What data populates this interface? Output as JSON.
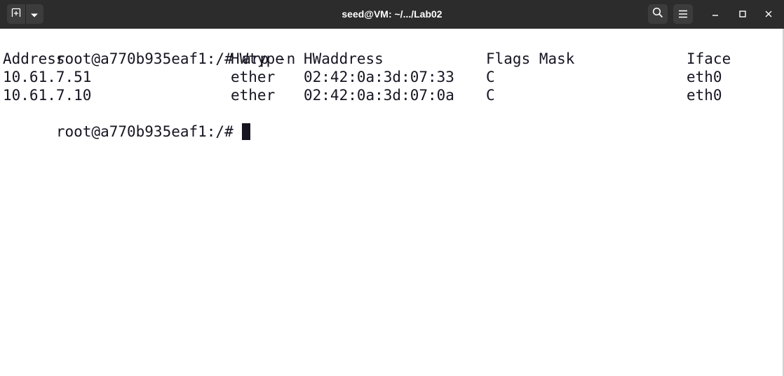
{
  "window": {
    "title": "seed@VM: ~/.../Lab02",
    "icons": [
      "new-tab-icon",
      "chevron-down-icon",
      "search-icon",
      "hamburger-menu-icon",
      "minimize-icon",
      "maximize-icon",
      "close-icon"
    ]
  },
  "terminal": {
    "command_line": {
      "prompt": "root@a770b935eaf1:/#",
      "command": "arp -n"
    },
    "headers": [
      "Address",
      "HWtype",
      "HWaddress",
      "Flags Mask",
      "Iface"
    ],
    "rows": [
      {
        "address": "10.61.7.51",
        "hwtype": "ether",
        "hwaddress": "02:42:0a:3d:07:33",
        "flags": "C",
        "iface": "eth0"
      },
      {
        "address": "10.61.7.10",
        "hwtype": "ether",
        "hwaddress": "02:42:0a:3d:07:0a",
        "flags": "C",
        "iface": "eth0"
      }
    ],
    "current_prompt": "root@a770b935eaf1:/#"
  },
  "colors": {
    "titlebar": "#2c2c2c",
    "terminal_bg": "#ffffff",
    "terminal_fg": "#171421"
  }
}
